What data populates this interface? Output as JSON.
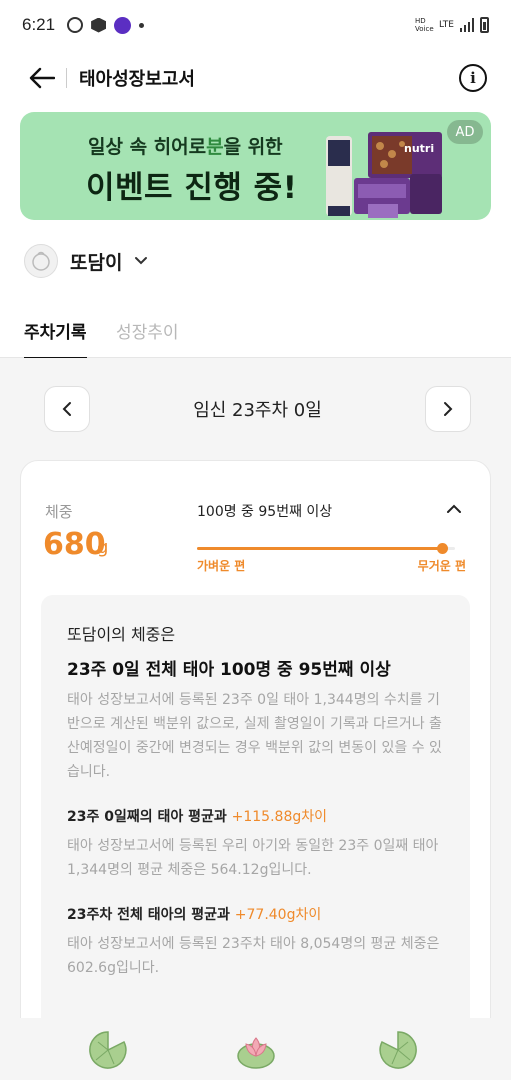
{
  "status_bar": {
    "time": "6:21",
    "network": "LTE",
    "volte": "HD Voice"
  },
  "header": {
    "title": "태아성장보고서"
  },
  "ad_banner": {
    "line1_part1": "일상 속 히어로",
    "line1_highlight": "분",
    "line1_part2": "을 위한",
    "line2": "이벤트 진행 중!",
    "badge": "AD",
    "product_text": "nutri"
  },
  "child": {
    "name": "또담이"
  },
  "tabs": [
    {
      "label": "주차기록",
      "active": true
    },
    {
      "label": "성장추이",
      "active": false
    }
  ],
  "week_nav": {
    "label": "임신 23주차 0일"
  },
  "weight_card": {
    "label": "체중",
    "value": "680",
    "unit": "g",
    "rank_text": "100명 중 95번째 이상",
    "percentile": 95,
    "scale_light": "가벼운 편",
    "scale_heavy": "무거운 편"
  },
  "detail": {
    "intro": "또담이의 체중은",
    "headline": "23주 0일 전체 태아 100명 중 95번째 이상",
    "description": "태아 성장보고서에 등록된 23주 0일 태아 1,344명의 수치를 기반으로 계산된 백분위 값으로, 실제 촬영일이 기록과 다르거나 출산예정일이 중간에 변경되는 경우 백분위 값의 변동이 있을 수 있습니다.",
    "sections": [
      {
        "title": "23주 0일째의 태아 평균과 ",
        "diff": "+115.88g차이",
        "description": "태아 성장보고서에 등록된 우리 아기와 동일한 23주 0일째 태아 1,344명의 평균 체중은 564.12g입니다."
      },
      {
        "title": "23주차 전체 태아의 평균과 ",
        "diff": "+77.40g차이",
        "description": "태아 성장보고서에 등록된 23주차 태아 8,054명의 평균 체중은 602.6g입니다."
      }
    ]
  },
  "colors": {
    "accent": "#ef8a2b",
    "ad_background": "#a5e3b3"
  }
}
